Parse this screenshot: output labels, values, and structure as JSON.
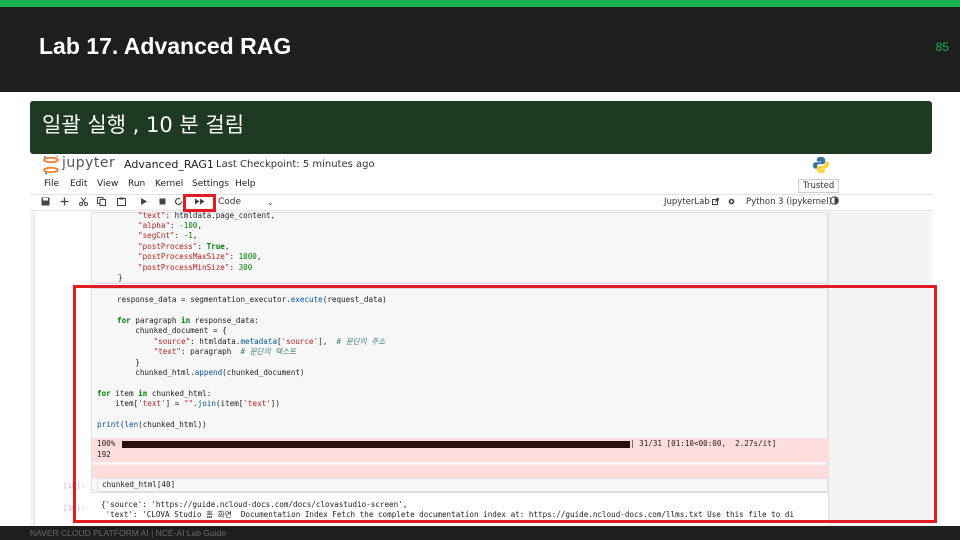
{
  "slide": {
    "title": "Lab 17. Advanced RAG",
    "page_number": "85",
    "subtitle": "일괄 실행 , 10 분 걸림",
    "footer": "NAVER CLOUD PLATFORM AI  |  NCE-AI Lab Guide"
  },
  "colors": {
    "accent": "#19b34f",
    "highlight": "#e31b23",
    "subtitle_bg": "#1f3a22",
    "header_bg": "#1e1e1e"
  },
  "jupyter": {
    "wordmark": "jupyter",
    "notebook_name": "Advanced_RAG1",
    "checkpoint": "Last Checkpoint: 5 minutes ago",
    "trusted": "Trusted",
    "menu": [
      "File",
      "Edit",
      "View",
      "Run",
      "Kernel",
      "Settings",
      "Help"
    ],
    "toolbar": {
      "icons": [
        "save-icon",
        "add-cell-icon",
        "cut-icon",
        "copy-icon",
        "paste-icon",
        "run-icon",
        "stop-icon",
        "restart-icon",
        "fast-forward-icon"
      ],
      "cell_type": "Code",
      "jupyterlab": "JupyterLab",
      "kernel": "Python 3 (ipykernel)"
    }
  },
  "cells": {
    "top_code_lines": [
      "\"text\": htmldata.page_content,",
      "\"alpha\": -100,",
      "\"segCnt\": -1,",
      "\"postProcess\": True,",
      "\"postProcessMaxSize\": 1000,",
      "\"postProcessMinSize\": 300",
      "}"
    ],
    "main_code_lines": [
      "response_data = segmentation_executor.execute(request_data)",
      "",
      "for paragraph in response_data:",
      "    chunked_document = {",
      "        \"source\": htmldata.metadata['source'],  # 문단의 주소",
      "        \"text\": paragraph  # 문단의 텍스트",
      "    }",
      "    chunked_html.append(chunked_document)",
      "",
      "for item in chunked_html:",
      "    item['text'] = \"\".join(item['text'])",
      "",
      "print(len(chunked_html))"
    ],
    "progress": {
      "percent_label": "100%",
      "fraction": 1.0,
      "stats": "| 31/31 [01:10<00:00,  2.27s/it]",
      "output": "192"
    },
    "prompt_in": "[10]:",
    "prompt_out": "[10]:",
    "next_code": "chunked_html[40]",
    "next_output_line1": "{'source': 'https://guide.ncloud-docs.com/docs/clovastudio-screen',",
    "next_output_line2": " 'text': 'CLOVA Studio 홈 화면  Documentation Index Fetch the complete documentation index at: https://guide.ncloud-docs.com/llms.txt Use this file to di"
  }
}
